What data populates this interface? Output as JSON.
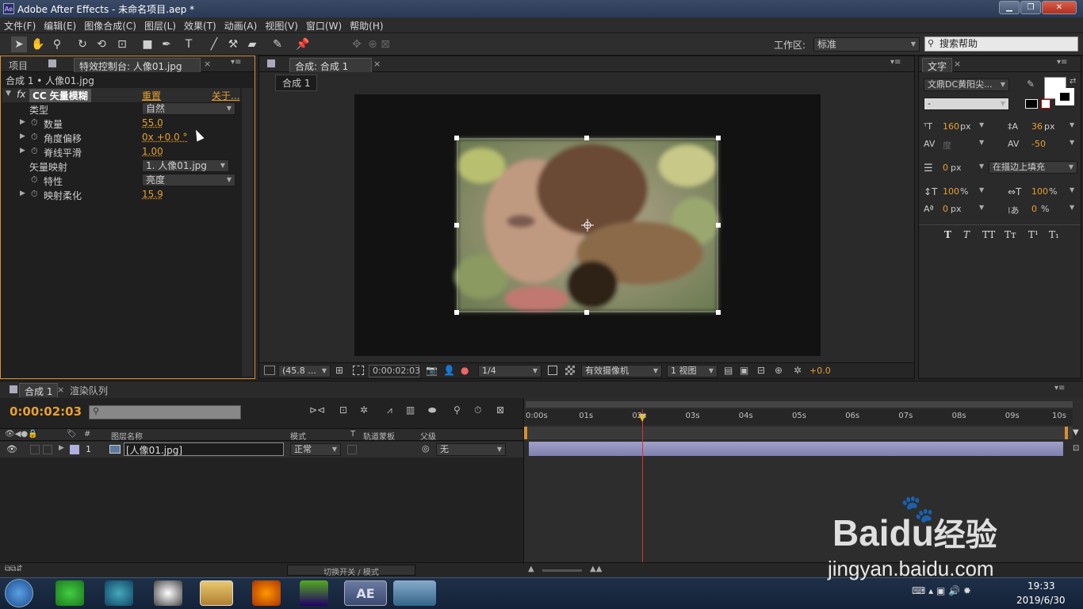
{
  "window": {
    "title": "Adobe After Effects - 未命名项目.aep *",
    "app_icon": "Ae"
  },
  "menu": [
    "文件(F)",
    "编辑(E)",
    "图像合成(C)",
    "图层(L)",
    "效果(T)",
    "动画(A)",
    "视图(V)",
    "窗口(W)",
    "帮助(H)"
  ],
  "toolbar": {
    "workspace_label": "工作区:",
    "workspace_value": "标准",
    "search_placeholder": "搜索帮助"
  },
  "left_panel": {
    "tabs": [
      "项目",
      "特效控制台: 人像01.jpg"
    ],
    "breadcrumb": "合成 1 • 人像01.jpg",
    "effect_name": "CC 矢量模糊",
    "reset": "重置",
    "about": "关于...",
    "props": [
      {
        "label": "类型",
        "value": "自然",
        "kind": "dropdown"
      },
      {
        "label": "数量",
        "value": "55.0"
      },
      {
        "label": "角度偏移",
        "value": "0x +0.0 °"
      },
      {
        "label": "脊线平滑",
        "value": "1.00"
      },
      {
        "label": "矢量映射",
        "value": "1. 人像01.jpg",
        "kind": "dropdown"
      },
      {
        "label": "特性",
        "value": "亮度",
        "kind": "dropdown"
      },
      {
        "label": "映射柔化",
        "value": "15.9"
      }
    ]
  },
  "comp_panel": {
    "tab": "合成: 合成 1",
    "subtab": "合成 1",
    "zoom": "(45.8 ...",
    "timecode": "0:00:02:03",
    "resolution": "1/4",
    "camera": "有效摄像机",
    "views": "1 视图",
    "exposure": "+0.0"
  },
  "char_panel": {
    "tab": "文字",
    "font": "文鼎DC黄阳尖...",
    "style": "-",
    "size": "160",
    "size_unit": "px",
    "leading": "36",
    "leading_unit": "px",
    "kerning": "度",
    "tracking": "-50",
    "stroke": "0",
    "stroke_unit": "px",
    "stroke_mode": "在描边上填充",
    "vscale": "100",
    "vscale_unit": "%",
    "hscale": "100",
    "hscale_unit": "%",
    "baseline": "0",
    "baseline_unit": "px",
    "tsume": "0",
    "tsume_unit": "%",
    "styles": [
      "T",
      "T",
      "TT",
      "Tт",
      "T¹",
      "T₁"
    ]
  },
  "timeline": {
    "tabs": [
      "合成 1",
      "渲染队列"
    ],
    "timecode": "0:00:02:03",
    "columns": [
      "图层名称",
      "模式",
      "T",
      "轨道蒙板",
      "父级"
    ],
    "layer": {
      "num": "1",
      "name": "[人像01.jpg]",
      "mode": "正常",
      "parent": "无"
    },
    "ruler": [
      "0:00s",
      "01s",
      "02s",
      "03s",
      "04s",
      "05s",
      "06s",
      "07s",
      "08s",
      "09s",
      "10s"
    ],
    "playhead_seconds": 2.1,
    "switch_label": "切换开关 / 模式"
  },
  "taskbar": {
    "time": "19:33",
    "date": "2019/6/30",
    "ae_label": "AE"
  },
  "watermark": {
    "brand": "Bai",
    "brand2": "du",
    "brand3": "经验",
    "url": "jingyan.baidu.com"
  }
}
